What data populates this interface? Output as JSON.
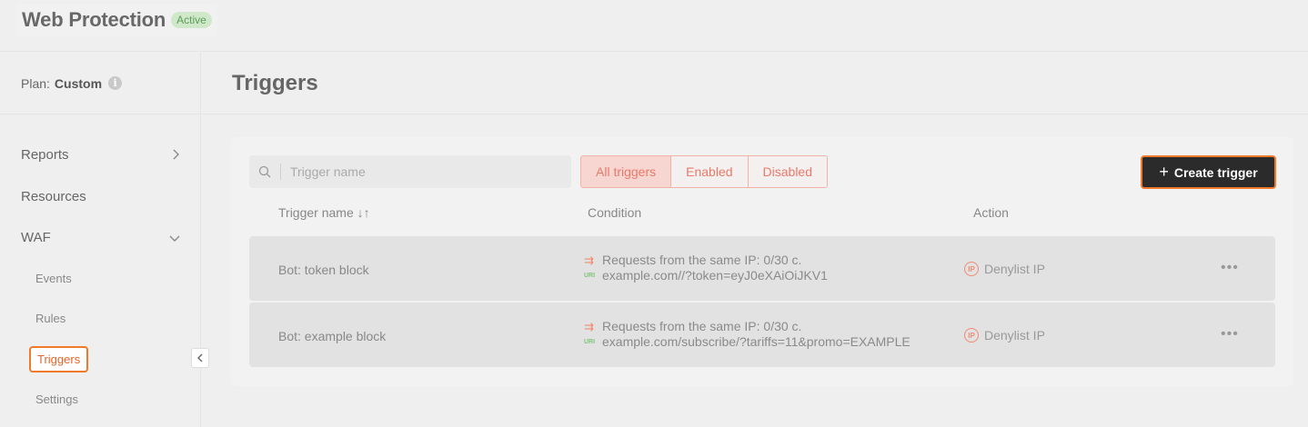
{
  "header": {
    "app_title": "Web Protection",
    "status_badge": "Active"
  },
  "sidebar": {
    "plan_label": "Plan:",
    "plan_value": "Custom",
    "items": [
      {
        "label": "Reports",
        "chevron": "chevron-right-icon"
      },
      {
        "label": "Resources"
      },
      {
        "label": "WAF",
        "chevron": "chevron-down-icon"
      }
    ],
    "waf_subitems": [
      "Events",
      "Rules",
      "Triggers",
      "Settings"
    ],
    "active_subitem": "Triggers"
  },
  "page": {
    "title": "Triggers"
  },
  "toolbar": {
    "search_placeholder": "Trigger name",
    "filters": [
      "All triggers",
      "Enabled",
      "Disabled"
    ],
    "active_filter": "All triggers",
    "create_label": "Create trigger"
  },
  "table": {
    "columns": [
      "Trigger name ↓↑",
      "Condition",
      "Action"
    ],
    "rows": [
      {
        "name": "Bot: token block",
        "condition_requests": "Requests from the same IP: 0/30 c.",
        "condition_uri": "example.com//?token=eyJ0eXAiOiJKV1",
        "action": "Denylist IP"
      },
      {
        "name": "Bot: example block",
        "condition_requests": "Requests from the same IP: 0/30 c.",
        "condition_uri": "example.com/subscribe/?tariffs=11&promo=EXAMPLE",
        "action": "Denylist IP"
      }
    ]
  },
  "colors": {
    "accent": "#f07a2a",
    "badge_green": "#cfe8c9",
    "filter_red": "#e97a6a"
  }
}
